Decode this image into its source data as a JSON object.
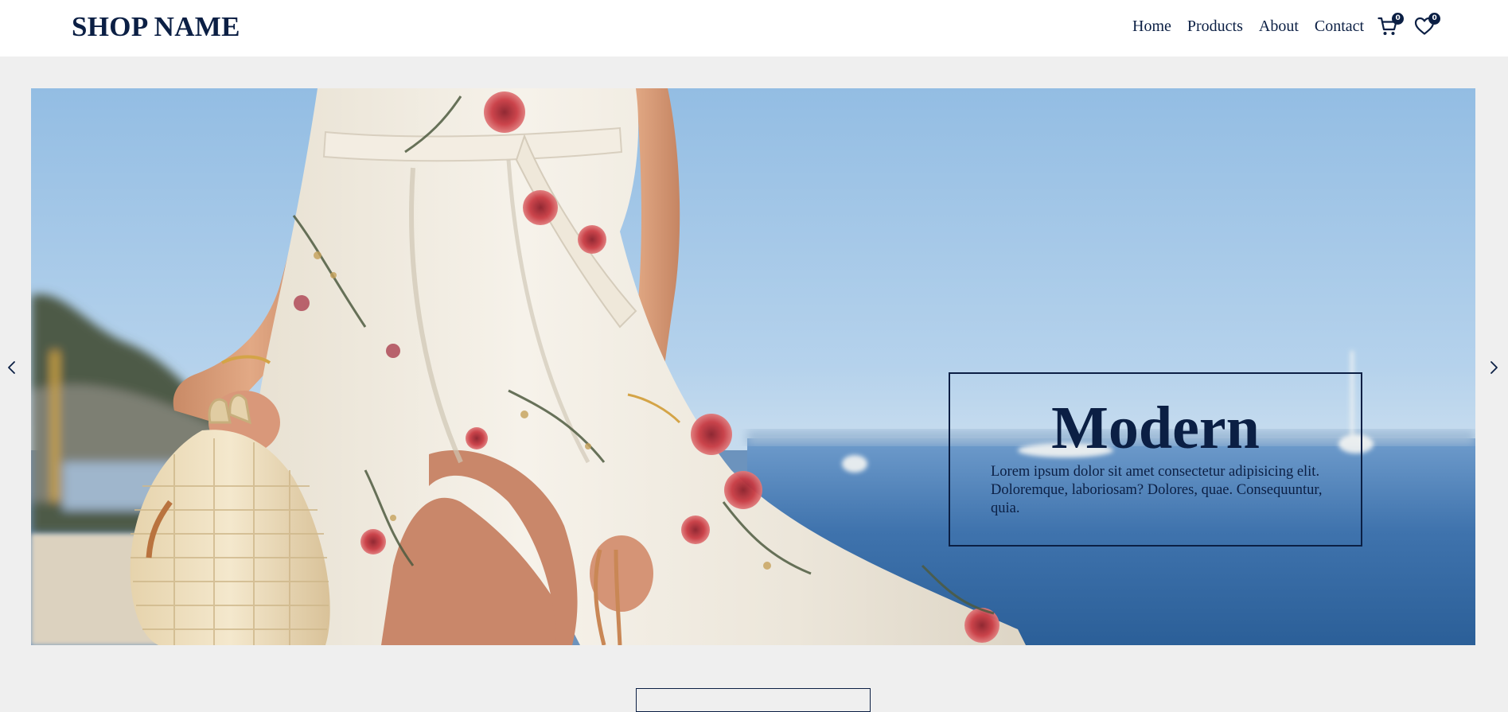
{
  "header": {
    "brand": "SHOP NAME",
    "nav": {
      "home": "Home",
      "products": "Products",
      "about": "About",
      "contact": "Contact"
    },
    "cart": {
      "icon": "cart-icon",
      "count": "0"
    },
    "wishlist": {
      "icon": "heart-icon",
      "count": "0"
    }
  },
  "hero": {
    "image": "woman in white floral wrap dress holding a wicker bag by the sea",
    "caption": {
      "title": "Modern",
      "text": "Lorem ipsum dolor sit amet consectetur adipisicing elit. Doloremque, laboriosam? Dolores, quae. Consequuntur, quia."
    },
    "prev_icon": "chevron-left-icon",
    "next_icon": "chevron-right-icon"
  },
  "colors": {
    "brand": "#0b1f44",
    "page_background": "#efefef",
    "header_background": "#ffffff"
  }
}
